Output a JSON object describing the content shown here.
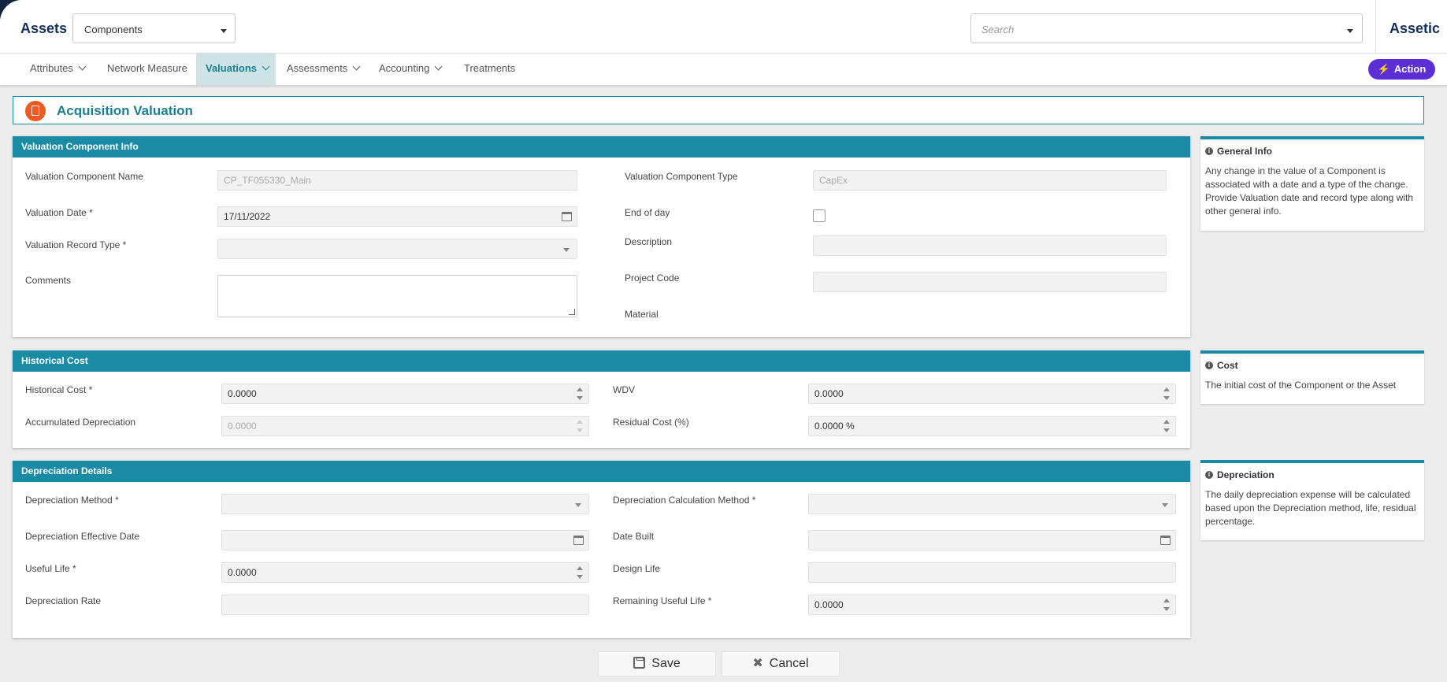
{
  "header": {
    "title": "Assets",
    "module_select": "Components",
    "search_placeholder": "Search",
    "brand": "Assetic"
  },
  "nav": {
    "items": [
      {
        "label": "Attributes",
        "dropdown": true
      },
      {
        "label": "Network Measure",
        "dropdown": false
      },
      {
        "label": "Valuations",
        "dropdown": true,
        "active": true
      },
      {
        "label": "Assessments",
        "dropdown": true
      },
      {
        "label": "Accounting",
        "dropdown": true
      },
      {
        "label": "Treatments",
        "dropdown": false
      }
    ],
    "action_label": "Action"
  },
  "page": {
    "title": "Acquisition Valuation"
  },
  "info_section": {
    "heading": "Valuation Component Info",
    "component_name_label": "Valuation Component Name",
    "component_name_value": "CP_TF055330_Main",
    "component_type_label": "Valuation Component Type",
    "component_type_value": "CapEx",
    "date_label": "Valuation Date *",
    "date_value": "17/11/2022",
    "end_of_day_label": "End of day",
    "record_type_label": "Valuation Record Type *",
    "description_label": "Description",
    "comments_label": "Comments",
    "project_code_label": "Project Code",
    "material_label": "Material"
  },
  "cost_section": {
    "heading": "Historical Cost",
    "historical_cost_label": "Historical Cost *",
    "historical_cost_value": "0.0000",
    "wdv_label": "WDV",
    "wdv_value": "0.0000",
    "accum_dep_label": "Accumulated Depreciation",
    "accum_dep_value": "0.0000",
    "residual_label": "Residual Cost (%)",
    "residual_value": "0.0000 %"
  },
  "dep_section": {
    "heading": "Depreciation Details",
    "method_label": "Depreciation Method *",
    "calc_method_label": "Depreciation Calculation Method *",
    "effective_date_label": "Depreciation Effective Date",
    "date_built_label": "Date Built",
    "useful_life_label": "Useful Life *",
    "useful_life_value": "0.0000",
    "design_life_label": "Design Life",
    "rate_label": "Depreciation Rate",
    "remaining_life_label": "Remaining Useful Life *",
    "remaining_life_value": "0.0000"
  },
  "cards": {
    "general": {
      "title": "General Info",
      "body": "Any change in the value of a Component is associated with a date and a type of the change. Provide Valuation date and record type along with other general info."
    },
    "cost": {
      "title": "Cost",
      "body": "The initial cost of the Component or the Asset"
    },
    "depreciation": {
      "title": "Depreciation",
      "body": "The daily depreciation expense will be calculated based upon the Depreciation method, life, residual percentage."
    }
  },
  "footer": {
    "save_label": "Save",
    "cancel_label": "Cancel"
  },
  "colors": {
    "accent": "#1a8ba5",
    "action": "#5b2ed6",
    "brand_dark": "#12305a",
    "title_icon": "#f05a22"
  }
}
